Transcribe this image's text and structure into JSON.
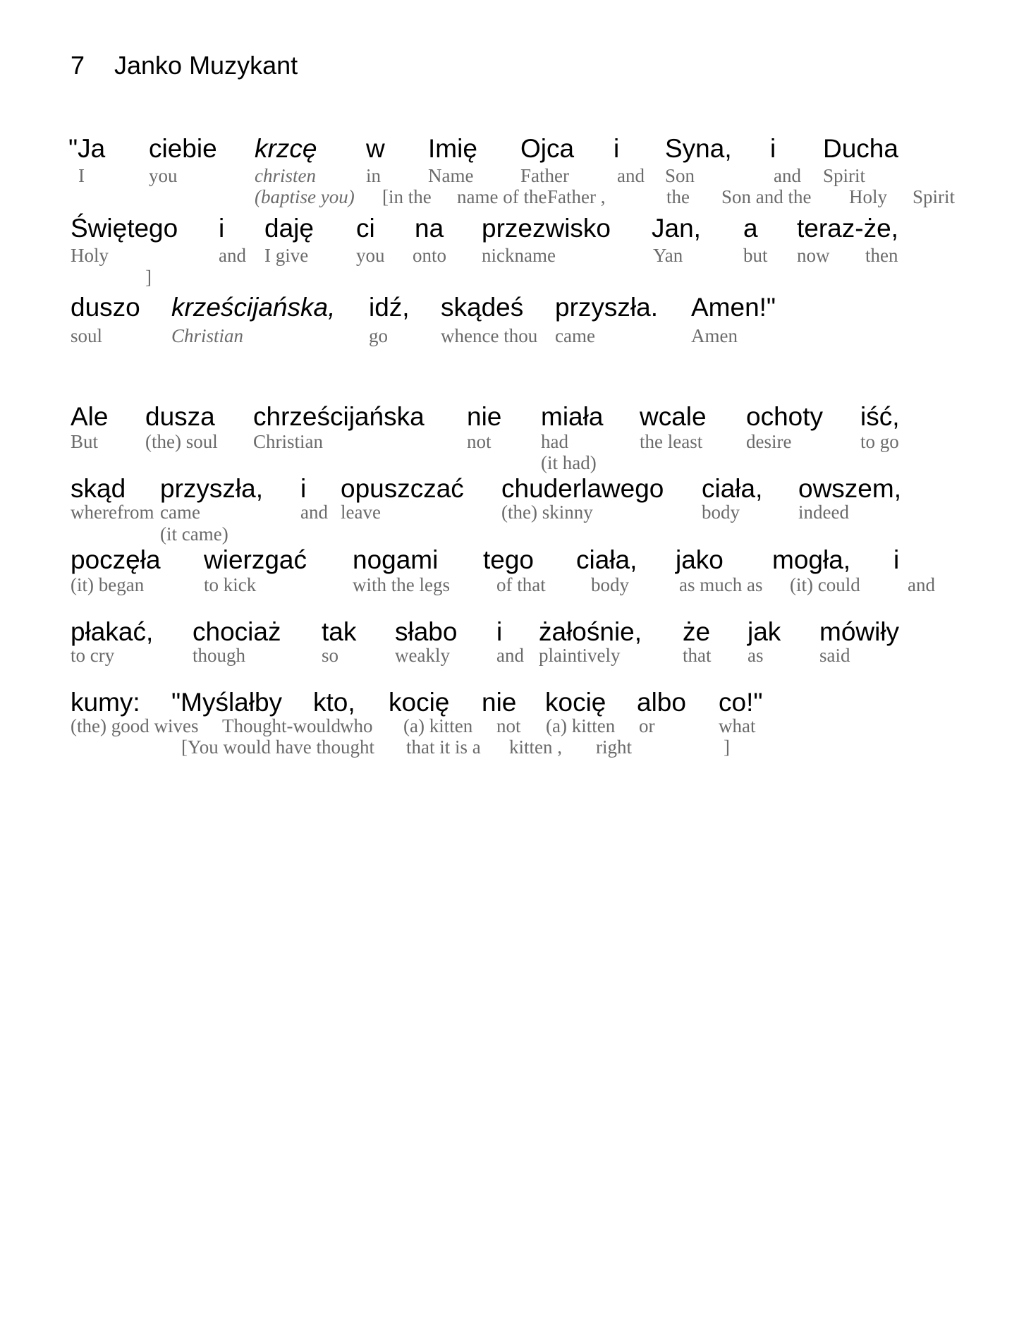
{
  "header": {
    "chapter_number": "7",
    "chapter_title": "Janko Muzykant"
  },
  "stanza1": {
    "line1": {
      "polish": [
        "\"Ja",
        "ciebie",
        "krzcę",
        "w",
        "Imię",
        "Ojca",
        "i",
        "Syna,",
        "i",
        "Ducha"
      ],
      "gloss": [
        "I",
        "you",
        "christen",
        "in",
        "Name",
        "Father",
        "and",
        "Son",
        "and",
        "Spirit"
      ],
      "gloss2": [
        "(baptise you)",
        "[in the",
        "name of the",
        "Father ,",
        "the",
        "Son and the",
        "Holy",
        "Spirit"
      ]
    },
    "line2": {
      "polish": [
        "Świętego",
        "i",
        "daję",
        "ci",
        "na",
        "przezwisko",
        "Jan,",
        "a",
        "teraz-że,"
      ],
      "gloss": [
        "Holy",
        "and",
        "I give",
        "you",
        "onto",
        "nickname",
        "Yan",
        "but",
        "now",
        "then"
      ],
      "gloss2": [
        "]"
      ]
    },
    "line3": {
      "polish": [
        "duszo",
        "krześcijańska,",
        "idź,",
        "skądeś",
        "przyszła.",
        "Amen!\""
      ],
      "gloss": [
        "soul",
        "Christian",
        "go",
        "whence thou",
        "came",
        "Amen"
      ]
    }
  },
  "stanza2": {
    "line1": {
      "polish": [
        "Ale",
        "dusza",
        "chrześcijańska",
        "nie",
        "miała",
        "wcale",
        "ochoty",
        "iść,"
      ],
      "gloss": [
        "But",
        "(the) soul",
        "Christian",
        "not",
        "had",
        "the least",
        "desire",
        "to go"
      ],
      "gloss2": [
        "(it had)"
      ]
    },
    "line2": {
      "polish": [
        "skąd",
        "przyszła,",
        "i",
        "opuszczać",
        "chuderlawego",
        "ciała,",
        "owszem,"
      ],
      "gloss": [
        "wherefrom",
        "came",
        "and",
        "leave",
        "(the) skinny",
        "body",
        "indeed"
      ],
      "gloss2": [
        "(it came)"
      ]
    },
    "line3": {
      "polish": [
        "poczęła",
        "wierzgać",
        "nogami",
        "tego",
        "ciała,",
        "jako",
        "mogła,",
        "i"
      ],
      "gloss": [
        "(it) began",
        "to kick",
        "with the legs",
        "of that",
        "body",
        "as much as",
        "(it) could",
        "and"
      ]
    },
    "line4": {
      "polish": [
        "płakać,",
        "chociaż",
        "tak",
        "słabo",
        "i",
        "żałośnie,",
        "że",
        "jak",
        "mówiły"
      ],
      "gloss": [
        "to cry",
        "though",
        "so",
        "weakly",
        "and",
        "plaintively",
        "that",
        "as",
        "said"
      ]
    },
    "line5": {
      "polish": [
        "kumy:",
        "\"Myślałby",
        "kto,",
        "kocię",
        "nie",
        "kocię",
        "albo",
        "co!\""
      ],
      "gloss": [
        "(the) good wives",
        "Thought-would",
        "who",
        "(a) kitten",
        "not",
        "(a) kitten",
        "or",
        "what"
      ],
      "gloss2": [
        "[You would have thought",
        "that it is a",
        "kitten ,",
        "right",
        "]"
      ]
    }
  }
}
